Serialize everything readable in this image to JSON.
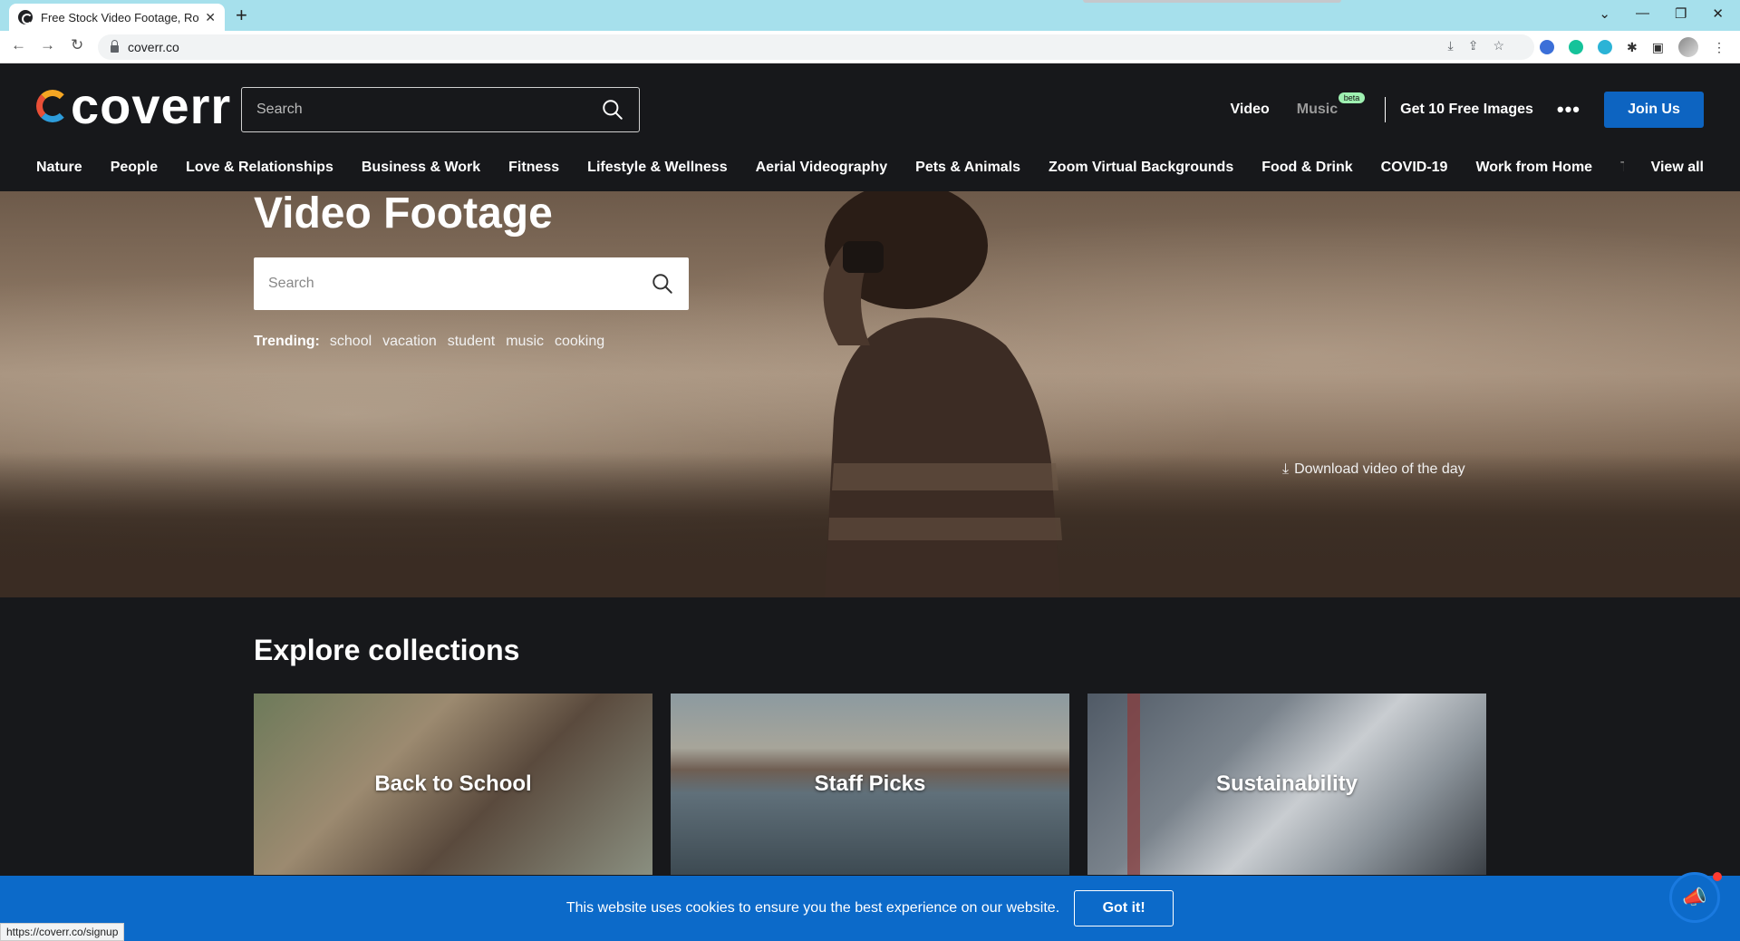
{
  "browser": {
    "tab_title": "Free Stock Video Footage, Roy",
    "address": "coverr.co",
    "status_url": "https://coverr.co/signup"
  },
  "header": {
    "logo_text": "coverr",
    "search_placeholder": "Search",
    "nav": {
      "video": "Video",
      "music": "Music",
      "music_badge": "beta",
      "free_images": "Get 10 Free Images",
      "more": "•••",
      "join": "Join Us"
    },
    "categories": [
      "Nature",
      "People",
      "Love & Relationships",
      "Business & Work",
      "Fitness",
      "Lifestyle & Wellness",
      "Aerial Videography",
      "Pets & Animals",
      "Zoom Virtual Backgrounds",
      "Food & Drink",
      "COVID-19",
      "Work from Home",
      "Travel &"
    ],
    "view_all": "View all"
  },
  "hero": {
    "title": "Video Footage",
    "search_placeholder": "Search",
    "trending_label": "Trending:",
    "trending": [
      "school",
      "vacation",
      "student",
      "music",
      "cooking"
    ],
    "download_label": "Download video of the day"
  },
  "collections": {
    "title": "Explore collections",
    "cards": [
      "Back to School",
      "Staff Picks",
      "Sustainability"
    ]
  },
  "cookie": {
    "text": "This website uses cookies to ensure you the best experience on our website.",
    "button": "Got it!"
  },
  "colors": {
    "brand_blue": "#0c6ac9",
    "header_bg": "#17181b",
    "beta_badge": "#9ef0b1"
  },
  "icons": {
    "search": "search-icon",
    "download": "download-icon",
    "feedback": "megaphone-icon"
  }
}
